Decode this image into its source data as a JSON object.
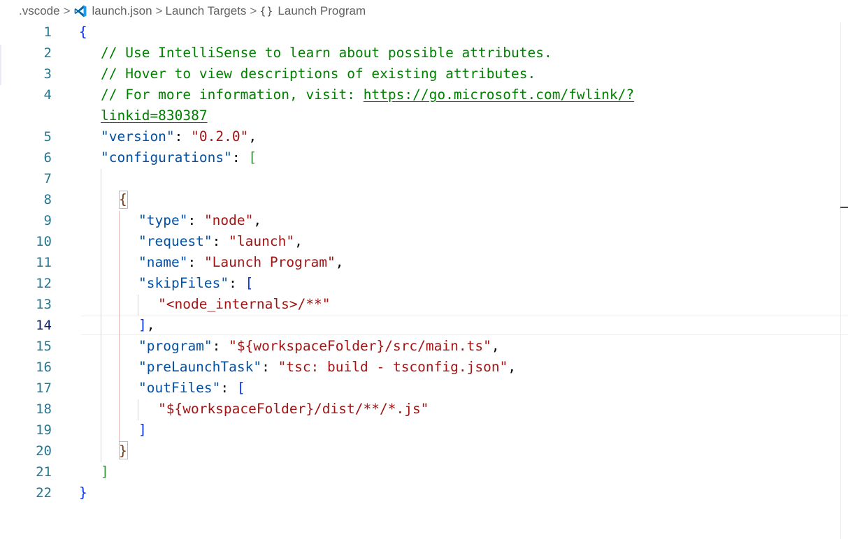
{
  "breadcrumb": {
    "folder": ".vscode",
    "file": "launch.json",
    "section": "Launch Targets",
    "symbol": "Launch Program",
    "separator": ">",
    "braces_icon": "{}"
  },
  "editor": {
    "language": "jsonc",
    "line_numbers": [
      "1",
      "2",
      "3",
      "4",
      "5",
      "6",
      "7",
      "8",
      "9",
      "10",
      "11",
      "12",
      "13",
      "14",
      "15",
      "16",
      "17",
      "18",
      "19",
      "20",
      "21",
      "22"
    ],
    "lines": {
      "l1": {
        "b": "{"
      },
      "l2": {
        "comment": "// Use IntelliSense to learn about possible attributes."
      },
      "l3": {
        "comment": "// Hover to view descriptions of existing attributes."
      },
      "l4": {
        "comment": "// For more information, visit: ",
        "link": "https://go.microsoft.com/fwlink/?",
        "link_cont": "linkid=830387"
      },
      "l5": {
        "key": "\"version\"",
        "colon": ": ",
        "value": "\"0.2.0\"",
        "comma": ","
      },
      "l6": {
        "key": "\"configurations\"",
        "colon": ": ",
        "b": "["
      },
      "l8": {
        "b": "{"
      },
      "l9": {
        "key": "\"type\"",
        "colon": ": ",
        "value": "\"node\"",
        "comma": ","
      },
      "l10": {
        "key": "\"request\"",
        "colon": ": ",
        "value": "\"launch\"",
        "comma": ","
      },
      "l11": {
        "key": "\"name\"",
        "colon": ": ",
        "value": "\"Launch Program\"",
        "comma": ","
      },
      "l12": {
        "key": "\"skipFiles\"",
        "colon": ": ",
        "b": "["
      },
      "l13": {
        "value": "\"<node_internals>/**\""
      },
      "l14": {
        "b": "]",
        "comma": ","
      },
      "l15": {
        "key": "\"program\"",
        "colon": ": ",
        "value": "\"${workspaceFolder}/src/main.ts\"",
        "comma": ","
      },
      "l16": {
        "key": "\"preLaunchTask\"",
        "colon": ": ",
        "value": "\"tsc: build - tsconfig.json\"",
        "comma": ","
      },
      "l17": {
        "key": "\"outFiles\"",
        "colon": ": ",
        "b": "["
      },
      "l18": {
        "value": "\"${workspaceFolder}/dist/**/*.js\""
      },
      "l19": {
        "b": "]"
      },
      "l20": {
        "b": "}"
      },
      "l21": {
        "b": "]"
      },
      "l22": {
        "b": "}"
      }
    },
    "active_line": 14
  },
  "colors": {
    "line_number": "#237893",
    "comment": "#008000",
    "json_key": "#0451a5",
    "json_string": "#a31515",
    "bracket_level1": "#0431fa",
    "bracket_level2": "#319331",
    "bracket_level3": "#7b3814"
  },
  "icons": {
    "breadcrumb_file_icon": "vscode-logo-icon",
    "breadcrumb_symbol_icon": "braces-icon"
  }
}
